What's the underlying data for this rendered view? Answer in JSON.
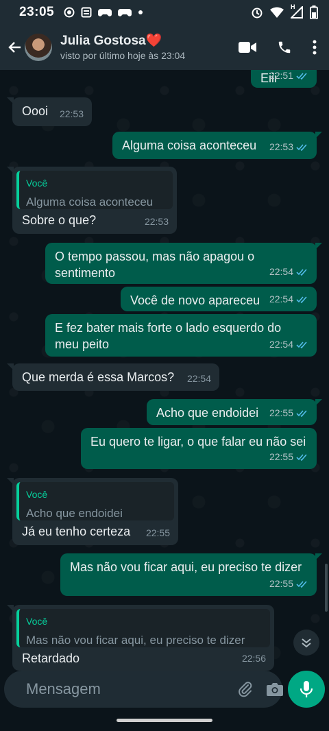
{
  "status_bar": {
    "time": "23:05",
    "network_type": "H"
  },
  "header": {
    "contact_name": "Julia Gostosa",
    "contact_emoji": "❤️",
    "last_seen": "visto por último hoje às 23:04"
  },
  "messages": [
    {
      "dir": "out",
      "text": "Eiii",
      "time": "22:51",
      "status": "read"
    },
    {
      "dir": "in",
      "text": "Oooi",
      "time": "22:53"
    },
    {
      "dir": "out",
      "text": "Alguma coisa aconteceu",
      "time": "22:53",
      "status": "read"
    },
    {
      "dir": "in",
      "quote_author": "Você",
      "quote_text": "Alguma coisa aconteceu",
      "text": "Sobre o que?",
      "time": "22:53"
    },
    {
      "dir": "out",
      "text": "O tempo passou, mas não apagou o\nsentimento",
      "time": "22:54",
      "status": "read"
    },
    {
      "dir": "out",
      "text": "Você de novo apareceu",
      "time": "22:54",
      "status": "read"
    },
    {
      "dir": "out",
      "text": "E fez bater mais forte o lado esquerdo do\nmeu peito",
      "time": "22:54",
      "status": "read"
    },
    {
      "dir": "in",
      "text": "Que merda é essa Marcos?",
      "time": "22:54"
    },
    {
      "dir": "out",
      "text": "Acho que endoidei",
      "time": "22:55",
      "status": "read"
    },
    {
      "dir": "out",
      "text": "Eu quero te ligar, o que falar eu não sei",
      "time": "22:55",
      "status": "read"
    },
    {
      "dir": "in",
      "quote_author": "Você",
      "quote_text": "Acho que endoidei",
      "text": "Já eu tenho certeza",
      "time": "22:55"
    },
    {
      "dir": "out",
      "text": "Mas não vou ficar aqui, eu preciso te dizer",
      "time": "22:55",
      "status": "read"
    },
    {
      "dir": "in",
      "quote_author": "Você",
      "quote_text": "Mas não vou ficar aqui, eu preciso te dizer",
      "text": "Retardado",
      "time": "22:56"
    }
  ],
  "composer": {
    "placeholder": "Mensagem"
  },
  "colors": {
    "accent": "#00a884",
    "outgoing_bubble": "#005c4b",
    "incoming_bubble": "#202c33",
    "read_ticks": "#53bdeb"
  }
}
